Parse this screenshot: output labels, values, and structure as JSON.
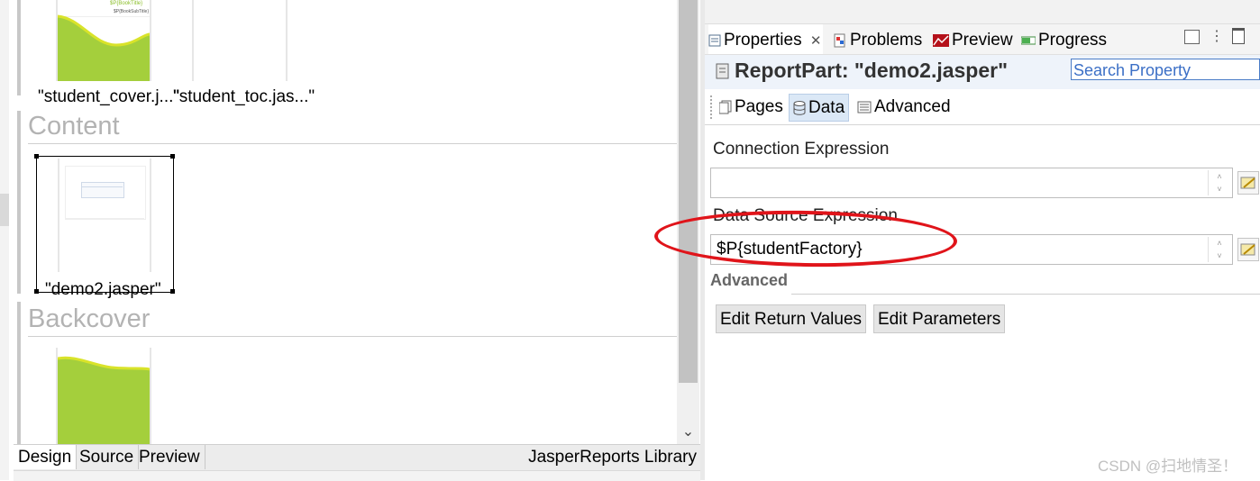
{
  "designer": {
    "cover_thumbnail_title_text": "$P{BookTitle}",
    "cover_thumbnail_subtitle_text": "$P{BookSubTitle}",
    "cover_items": [
      {
        "label": "\"student_cover.j...\""
      },
      {
        "label": "\"student_toc.jas...\""
      }
    ],
    "sections": {
      "content_title": "Content",
      "backcover_title": "Backcover"
    },
    "content_items": [
      {
        "label": "\"demo2.jasper\""
      }
    ],
    "bottom_tabs": [
      "Design",
      "Source",
      "Preview"
    ],
    "active_bottom_tab": "Design",
    "library_label": "JasperReports Library",
    "accent_green": "#a4cf3c"
  },
  "properties": {
    "view_tabs": [
      {
        "label": "Properties",
        "icon": "properties-icon",
        "closable": true
      },
      {
        "label": "Problems",
        "icon": "problems-icon"
      },
      {
        "label": "Preview",
        "icon": "preview-chart-icon"
      },
      {
        "label": "Progress",
        "icon": "progress-icon"
      }
    ],
    "header_title": "ReportPart: \"demo2.jasper\"",
    "search_placeholder": "Search Property",
    "page_tabs": [
      {
        "label": "Pages",
        "icon": "pages-icon"
      },
      {
        "label": "Data",
        "icon": "database-icon"
      },
      {
        "label": "Advanced",
        "icon": "advanced-icon"
      }
    ],
    "active_page_tab": "Data",
    "connection_expression_label": "Connection Expression",
    "connection_expression_value": "",
    "datasource_expression_label": "Data Source Expression",
    "datasource_expression_value": "$P{studentFactory}",
    "advanced_section_label": "Advanced",
    "buttons": {
      "edit_return_values": "Edit Return Values",
      "edit_parameters": "Edit Parameters"
    },
    "annotation_color": "#e0141a"
  },
  "watermark": "CSDN @扫地情圣！"
}
